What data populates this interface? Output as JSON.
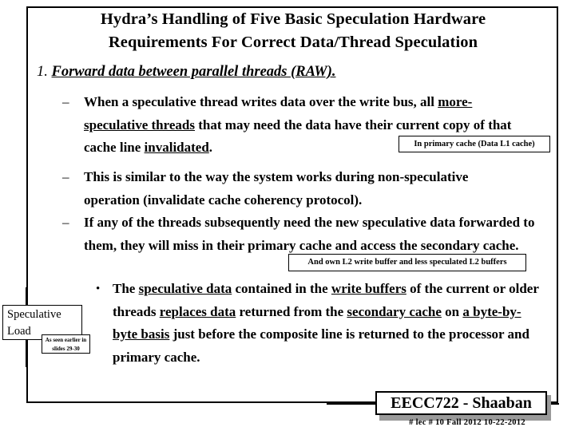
{
  "slide": {
    "title_lines": [
      "Hydra’s Handling of Five Basic Speculation Hardware",
      "Requirements For Correct Data/Thread Speculation"
    ],
    "heading": {
      "number": "1.",
      "text": "Forward data between parallel threads (RAW)."
    },
    "bullets": [
      {
        "marker": "–",
        "segments": [
          {
            "text": "When a speculative thread writes data over the write bus, all ",
            "underline": false
          },
          {
            "text": "more-speculative threads",
            "underline": true
          },
          {
            "text": " that may need the data have their current copy of that cache line ",
            "underline": false
          },
          {
            "text": "invalidated",
            "underline": true
          },
          {
            "text": ".",
            "underline": false
          }
        ]
      },
      {
        "marker": "–",
        "segments": [
          {
            "text": "This is similar to the way the system works during non-speculative operation (invalidate cache coherency protocol).",
            "underline": false
          }
        ]
      },
      {
        "marker": "–",
        "segments": [
          {
            "text": "If any of the threads subsequently need the new speculative data forwarded to them, they will miss in their primary cache and access the secondary cache.",
            "underline": false
          }
        ]
      }
    ],
    "sub_bullet": {
      "marker": "•",
      "segments": [
        {
          "text": "The ",
          "underline": false
        },
        {
          "text": "speculative data",
          "underline": true
        },
        {
          "text": " contained in the ",
          "underline": false
        },
        {
          "text": "write buffers",
          "underline": true
        },
        {
          "text": " of the current or older threads ",
          "underline": false
        },
        {
          "text": "replaces data",
          "underline": true
        },
        {
          "text": " returned from the ",
          "underline": false
        },
        {
          "text": "secondary cache",
          "underline": true
        },
        {
          "text": " on ",
          "underline": false
        },
        {
          "text": "a byte-by-byte basis",
          "underline": true
        },
        {
          "text": " just before the composite line is returned to the processor and primary cache.",
          "underline": false
        }
      ]
    },
    "callouts": {
      "primary_cache": "In primary cache (Data L1 cache)",
      "l2_buffers": "And own L2 write buffer and less speculated L2 buffers",
      "slides_ref": "As seen earlier in slides 29-30"
    },
    "speculative_load_label": "Speculative Load",
    "footer": {
      "course": "EECC722 - Shaaban",
      "meta": "# lec # 10    Fall 2012    10-22-2012"
    },
    "colors": {
      "text": "#000000",
      "border": "#000000",
      "shadow": "#9a9a9a",
      "background": "#ffffff"
    }
  }
}
